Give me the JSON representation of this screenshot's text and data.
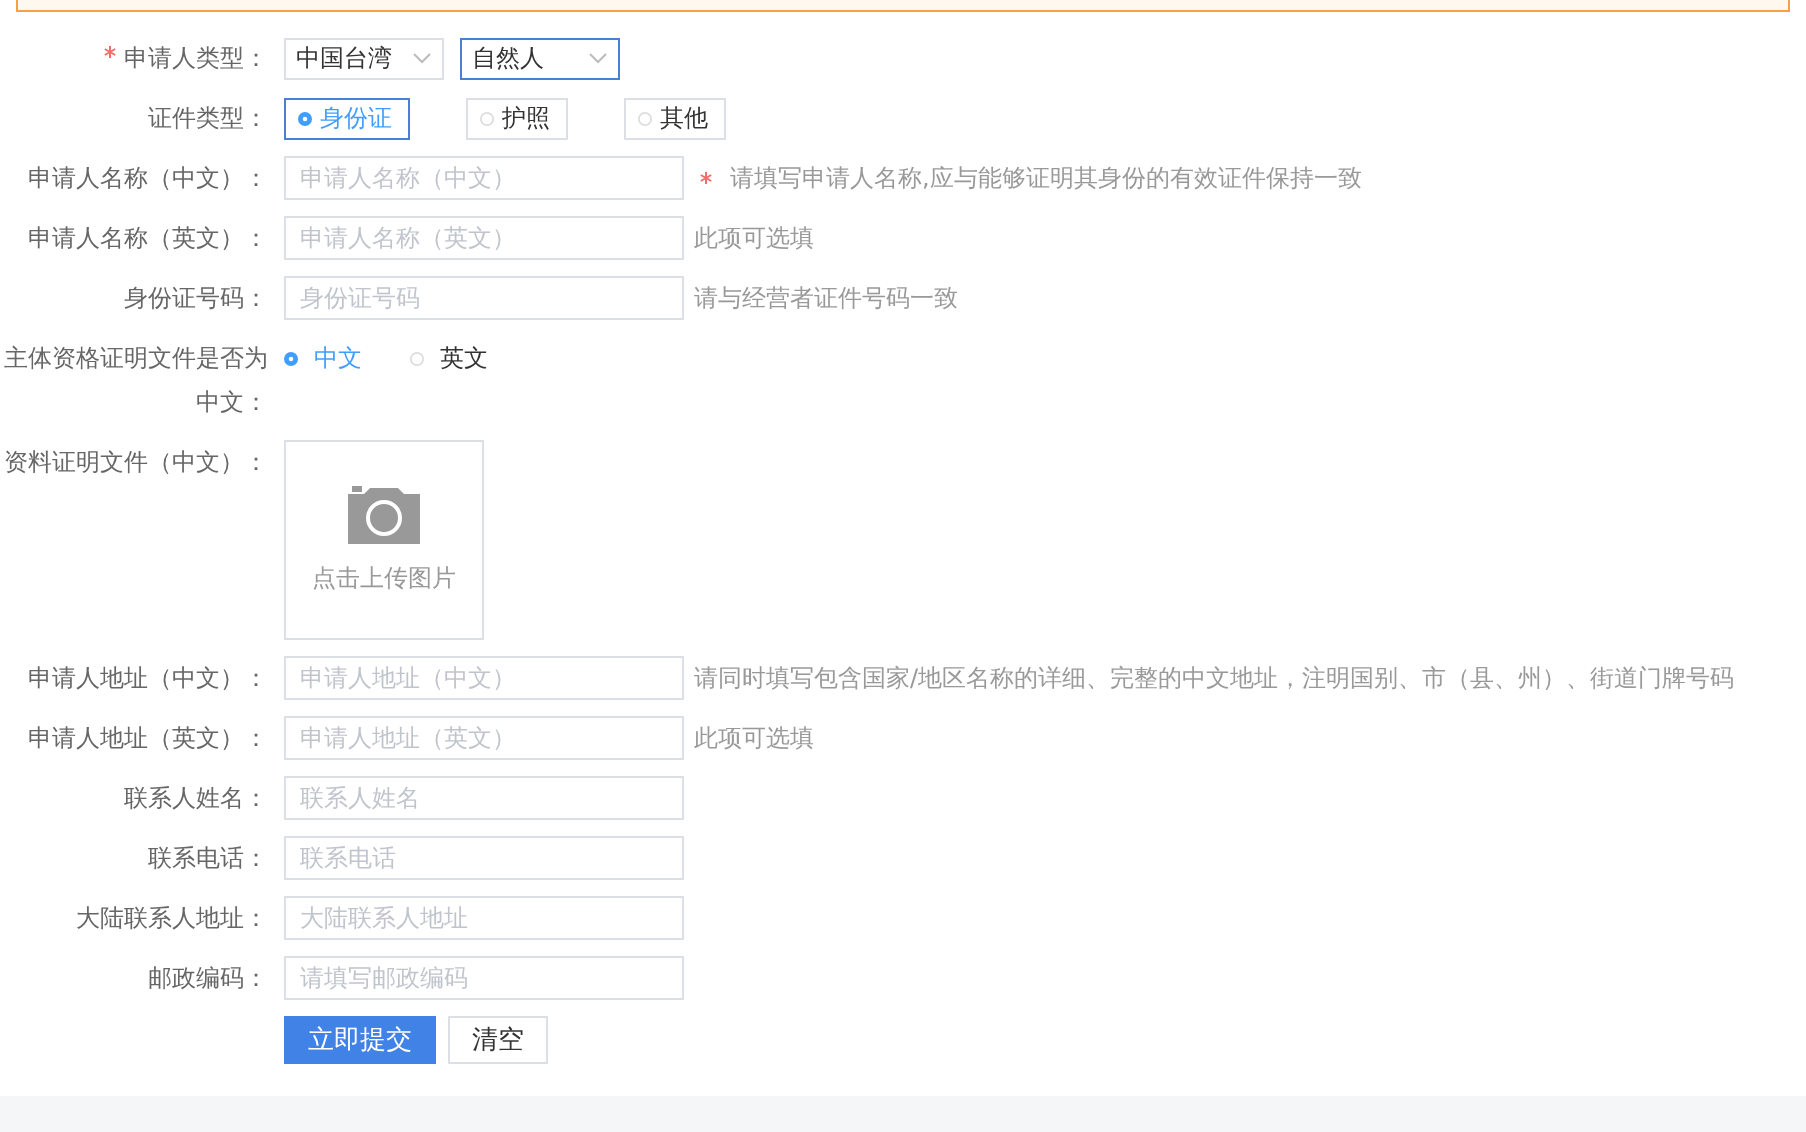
{
  "rows": [
    {
      "kind": "selects",
      "label": "申请人类型：",
      "required": true,
      "selects": [
        {
          "value": "中国台湾",
          "focused": false
        },
        {
          "value": "自然人",
          "focused": true
        }
      ]
    },
    {
      "kind": "boxed_radios",
      "label": "证件类型：",
      "required": false,
      "options": [
        {
          "label": "身份证",
          "selected": true
        },
        {
          "label": "护照",
          "selected": false
        },
        {
          "label": "其他",
          "selected": false
        }
      ]
    },
    {
      "kind": "text",
      "label": "申请人名称（中文）：",
      "required": false,
      "placeholder": "申请人名称（中文）",
      "hint": "请填写申请人名称,应与能够证明其身份的有效证件保持一致",
      "hint_required": true
    },
    {
      "kind": "text",
      "label": "申请人名称（英文）：",
      "required": false,
      "placeholder": "申请人名称（英文）",
      "hint": "此项可选填",
      "hint_required": false
    },
    {
      "kind": "text",
      "label": "身份证号码：",
      "required": false,
      "placeholder": "身份证号码",
      "hint": "请与经营者证件号码一致",
      "hint_required": false
    },
    {
      "kind": "radios",
      "label": "主体资格证明文件是否为中文：",
      "required": false,
      "options": [
        {
          "label": "中文",
          "selected": true
        },
        {
          "label": "英文",
          "selected": false
        }
      ]
    },
    {
      "kind": "upload",
      "label": "资料证明文件（中文）：",
      "required": false,
      "text": "点击上传图片"
    },
    {
      "kind": "text",
      "label": "申请人地址（中文）：",
      "required": false,
      "placeholder": "申请人地址（中文）",
      "hint": "请同时填写包含国家/地区名称的详细、完整的中文地址，注明国别、市（县、州）、街道门牌号码",
      "hint_required": false
    },
    {
      "kind": "text",
      "label": "申请人地址（英文）：",
      "required": false,
      "placeholder": "申请人地址（英文）",
      "hint": "此项可选填",
      "hint_required": false
    },
    {
      "kind": "text",
      "label": "联系人姓名：",
      "required": false,
      "placeholder": "联系人姓名"
    },
    {
      "kind": "text",
      "label": "联系电话：",
      "required": false,
      "placeholder": "联系电话"
    },
    {
      "kind": "text",
      "label": "大陆联系人地址：",
      "required": false,
      "placeholder": "大陆联系人地址"
    },
    {
      "kind": "text",
      "label": "邮政编码：",
      "required": false,
      "placeholder": "请填写邮政编码"
    }
  ],
  "buttons": [
    {
      "label": "立即提交",
      "primary": true
    },
    {
      "label": "清空",
      "primary": false
    }
  ]
}
